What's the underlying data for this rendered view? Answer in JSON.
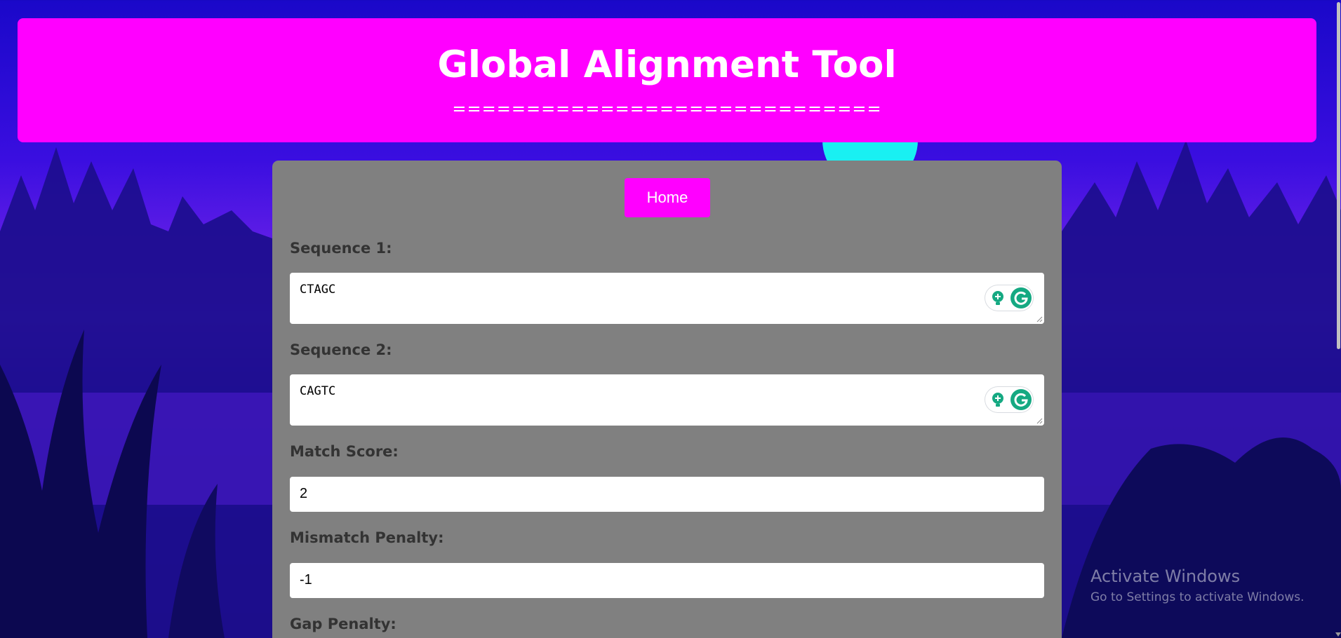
{
  "header": {
    "title": "Global Alignment Tool",
    "divider": "============================="
  },
  "nav": {
    "home_label": "Home"
  },
  "form": {
    "sequence1": {
      "label": "Sequence 1:",
      "value": "CTAGC"
    },
    "sequence2": {
      "label": "Sequence 2:",
      "value": "CAGTC"
    },
    "match_score": {
      "label": "Match Score:",
      "value": "2"
    },
    "mismatch_penalty": {
      "label": "Mismatch Penalty:",
      "value": "-1"
    },
    "gap_penalty": {
      "label": "Gap Penalty:"
    }
  },
  "watermark": {
    "title": "Activate Windows",
    "subtitle": "Go to Settings to activate Windows."
  },
  "colors": {
    "header_bg": "#ff00ff",
    "panel_bg": "#808080",
    "button_bg": "#ff00ff",
    "label_color": "#333333",
    "grammarly_green": "#15a982"
  },
  "icons": [
    "grammarly-suggestion-icon",
    "grammarly-logo-icon",
    "resize-handle-icon"
  ]
}
